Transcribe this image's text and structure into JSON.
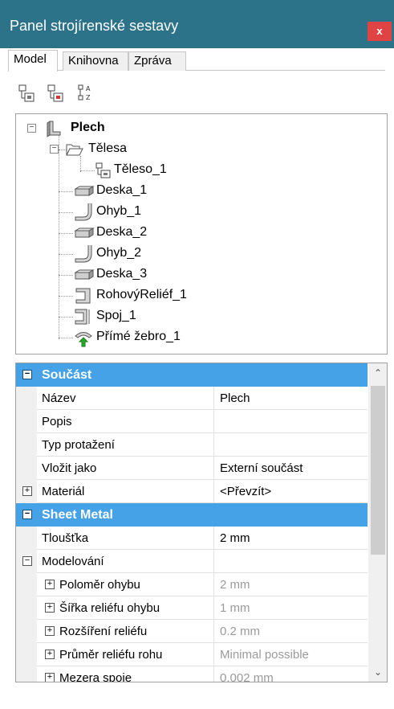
{
  "window": {
    "title": "Panel strojírenské sestavy",
    "close_label": "x"
  },
  "tabs": [
    {
      "label": "Model",
      "active": true
    },
    {
      "label": "Knihovna",
      "active": false
    },
    {
      "label": "Zpráva",
      "active": false
    }
  ],
  "toolbar": {
    "buttons": [
      "add-component-icon",
      "remove-component-icon",
      "sort-az-icon"
    ],
    "sort_glyph": "A Z"
  },
  "tree": {
    "root": {
      "label": "Plech",
      "icon": "sheet-metal-part-icon",
      "expander": "−"
    },
    "folder": {
      "label": "Tělesa",
      "icon": "open-folder-icon",
      "expander": "−"
    },
    "items": [
      {
        "label": "Těleso_1",
        "icon": "body-icon"
      },
      {
        "label": "Deska_1",
        "icon": "plate-icon"
      },
      {
        "label": "Ohyb_1",
        "icon": "bend-icon"
      },
      {
        "label": "Deska_2",
        "icon": "plate-icon"
      },
      {
        "label": "Ohyb_2",
        "icon": "bend-icon"
      },
      {
        "label": "Deska_3",
        "icon": "plate-icon"
      },
      {
        "label": "RohovýReliéf_1",
        "icon": "corner-relief-icon"
      },
      {
        "label": "Spoj_1",
        "icon": "joint-icon"
      },
      {
        "label": "Přímé žebro_1",
        "icon": "straight-rib-icon"
      }
    ]
  },
  "properties": {
    "rows": [
      {
        "kind": "cat",
        "expander": "−",
        "name": "Součást",
        "value": ""
      },
      {
        "kind": "row",
        "expander": "",
        "name": "Název",
        "value": "Plech"
      },
      {
        "kind": "row",
        "expander": "",
        "name": "Popis",
        "value": ""
      },
      {
        "kind": "row",
        "expander": "",
        "name": "Typ protažení",
        "value": ""
      },
      {
        "kind": "row",
        "expander": "",
        "name": "Vložit jako",
        "value": "Externí součást"
      },
      {
        "kind": "row",
        "expander": "+",
        "name": "Materiál",
        "value": "<Převzít>"
      },
      {
        "kind": "cat",
        "expander": "−",
        "name": "Sheet Metal",
        "value": ""
      },
      {
        "kind": "row",
        "expander": "",
        "name": "Tloušťka",
        "value": "2 mm"
      },
      {
        "kind": "row",
        "expander": "−",
        "name": "Modelování",
        "value": ""
      },
      {
        "kind": "sub",
        "expander": "+",
        "name": "Poloměr ohybu",
        "value": "2 mm"
      },
      {
        "kind": "sub",
        "expander": "+",
        "name": "Šířka reliéfu ohybu",
        "value": "1 mm"
      },
      {
        "kind": "sub",
        "expander": "+",
        "name": "Rozšíření reliéfu",
        "value": "0.2 mm"
      },
      {
        "kind": "sub",
        "expander": "+",
        "name": "Průměr reliéfu rohu",
        "value": "Minimal possible"
      },
      {
        "kind": "sub",
        "expander": "+",
        "name": "Mezera spoje",
        "value": "0.002 mm"
      }
    ]
  },
  "scrollbar": {
    "up": "⌃",
    "down": "⌄"
  },
  "colors": {
    "titlebar": "#2c7389",
    "close": "#e04343",
    "category": "#45a2e6"
  }
}
